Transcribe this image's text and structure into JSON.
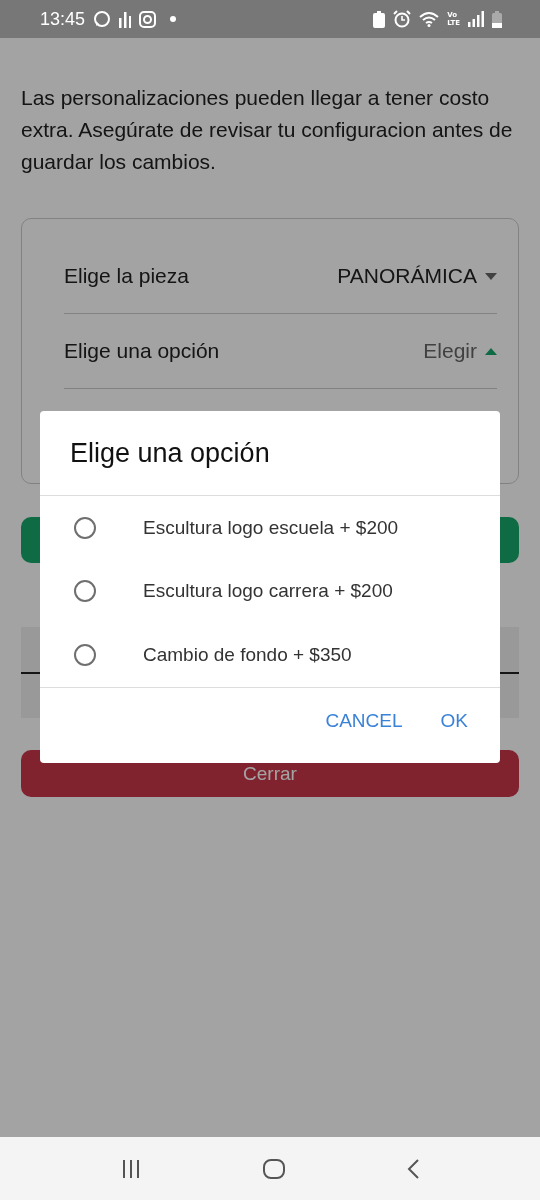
{
  "status_bar": {
    "time": "13:45",
    "network_label": [
      "Vo",
      "LTE"
    ]
  },
  "notice": "Las personalizaciones pueden llegar a tener costo extra. Asegúrate de revisar tu configuracion antes de guardar los cambios.",
  "selects": [
    {
      "label": "Elige la pieza",
      "value": "PANORÁMICA",
      "expanded": false
    },
    {
      "label": "Elige una opción",
      "value": "Elegir",
      "expanded": true
    }
  ],
  "close_button": "Cerrar",
  "dialog": {
    "title": "Elige una opción",
    "options": [
      {
        "label": "Escultura logo escuela + $200",
        "selected": false
      },
      {
        "label": "Escultura logo carrera + $200",
        "selected": false
      },
      {
        "label": "Cambio de fondo + $350",
        "selected": false
      }
    ],
    "buttons": [
      "CANCEL",
      "OK"
    ]
  }
}
